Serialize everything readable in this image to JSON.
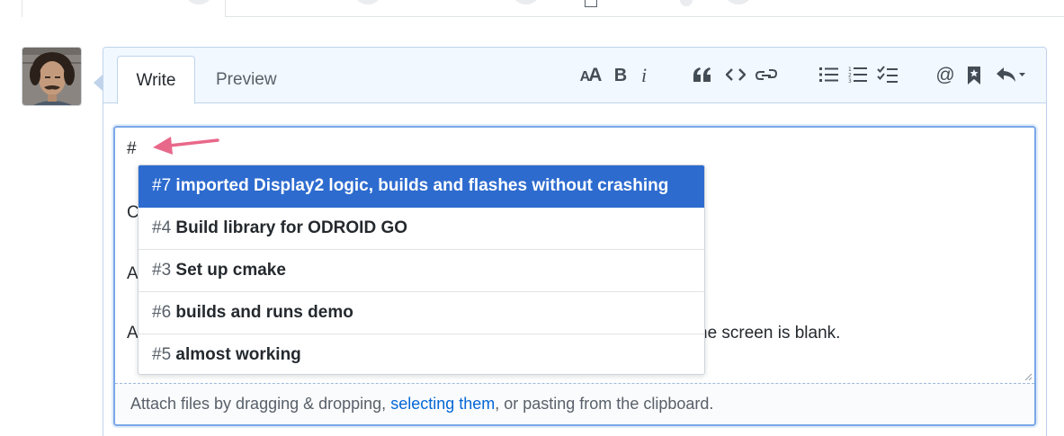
{
  "tabs": {
    "write": "Write",
    "preview": "Preview"
  },
  "toolbar": {
    "items": [
      {
        "name": "header-text-icon",
        "glyph": "AA"
      },
      {
        "name": "bold-icon",
        "glyph": "B"
      },
      {
        "name": "italic-icon",
        "glyph": "i"
      },
      {
        "name": "quote-icon"
      },
      {
        "name": "code-icon",
        "glyph": "<>"
      },
      {
        "name": "link-icon"
      },
      {
        "name": "unordered-list-icon"
      },
      {
        "name": "ordered-list-icon"
      },
      {
        "name": "task-list-icon"
      },
      {
        "name": "mention-icon",
        "glyph": "@"
      },
      {
        "name": "bookmark-icon"
      },
      {
        "name": "reply-icon"
      }
    ]
  },
  "editor": {
    "first_line": "#",
    "partial_lines": [
      "C",
      "A",
      "A"
    ],
    "tail_text": "ne screen is blank."
  },
  "suggestions": [
    {
      "num": "#7",
      "title": "imported Display2 logic, builds and flashes without crashing",
      "selected": true
    },
    {
      "num": "#4",
      "title": "Build library for ODROID GO",
      "selected": false
    },
    {
      "num": "#3",
      "title": "Set up cmake",
      "selected": false
    },
    {
      "num": "#6",
      "title": "builds and runs demo",
      "selected": false
    },
    {
      "num": "#5",
      "title": "almost working",
      "selected": false
    }
  ],
  "attach": {
    "before": "Attach files by dragging & dropping, ",
    "link": "selecting them",
    "after": ", or pasting from the clipboard."
  },
  "colors": {
    "accent": "#2d6bcf",
    "link": "#0366d6",
    "annotation_arrow": "#e8688a"
  }
}
